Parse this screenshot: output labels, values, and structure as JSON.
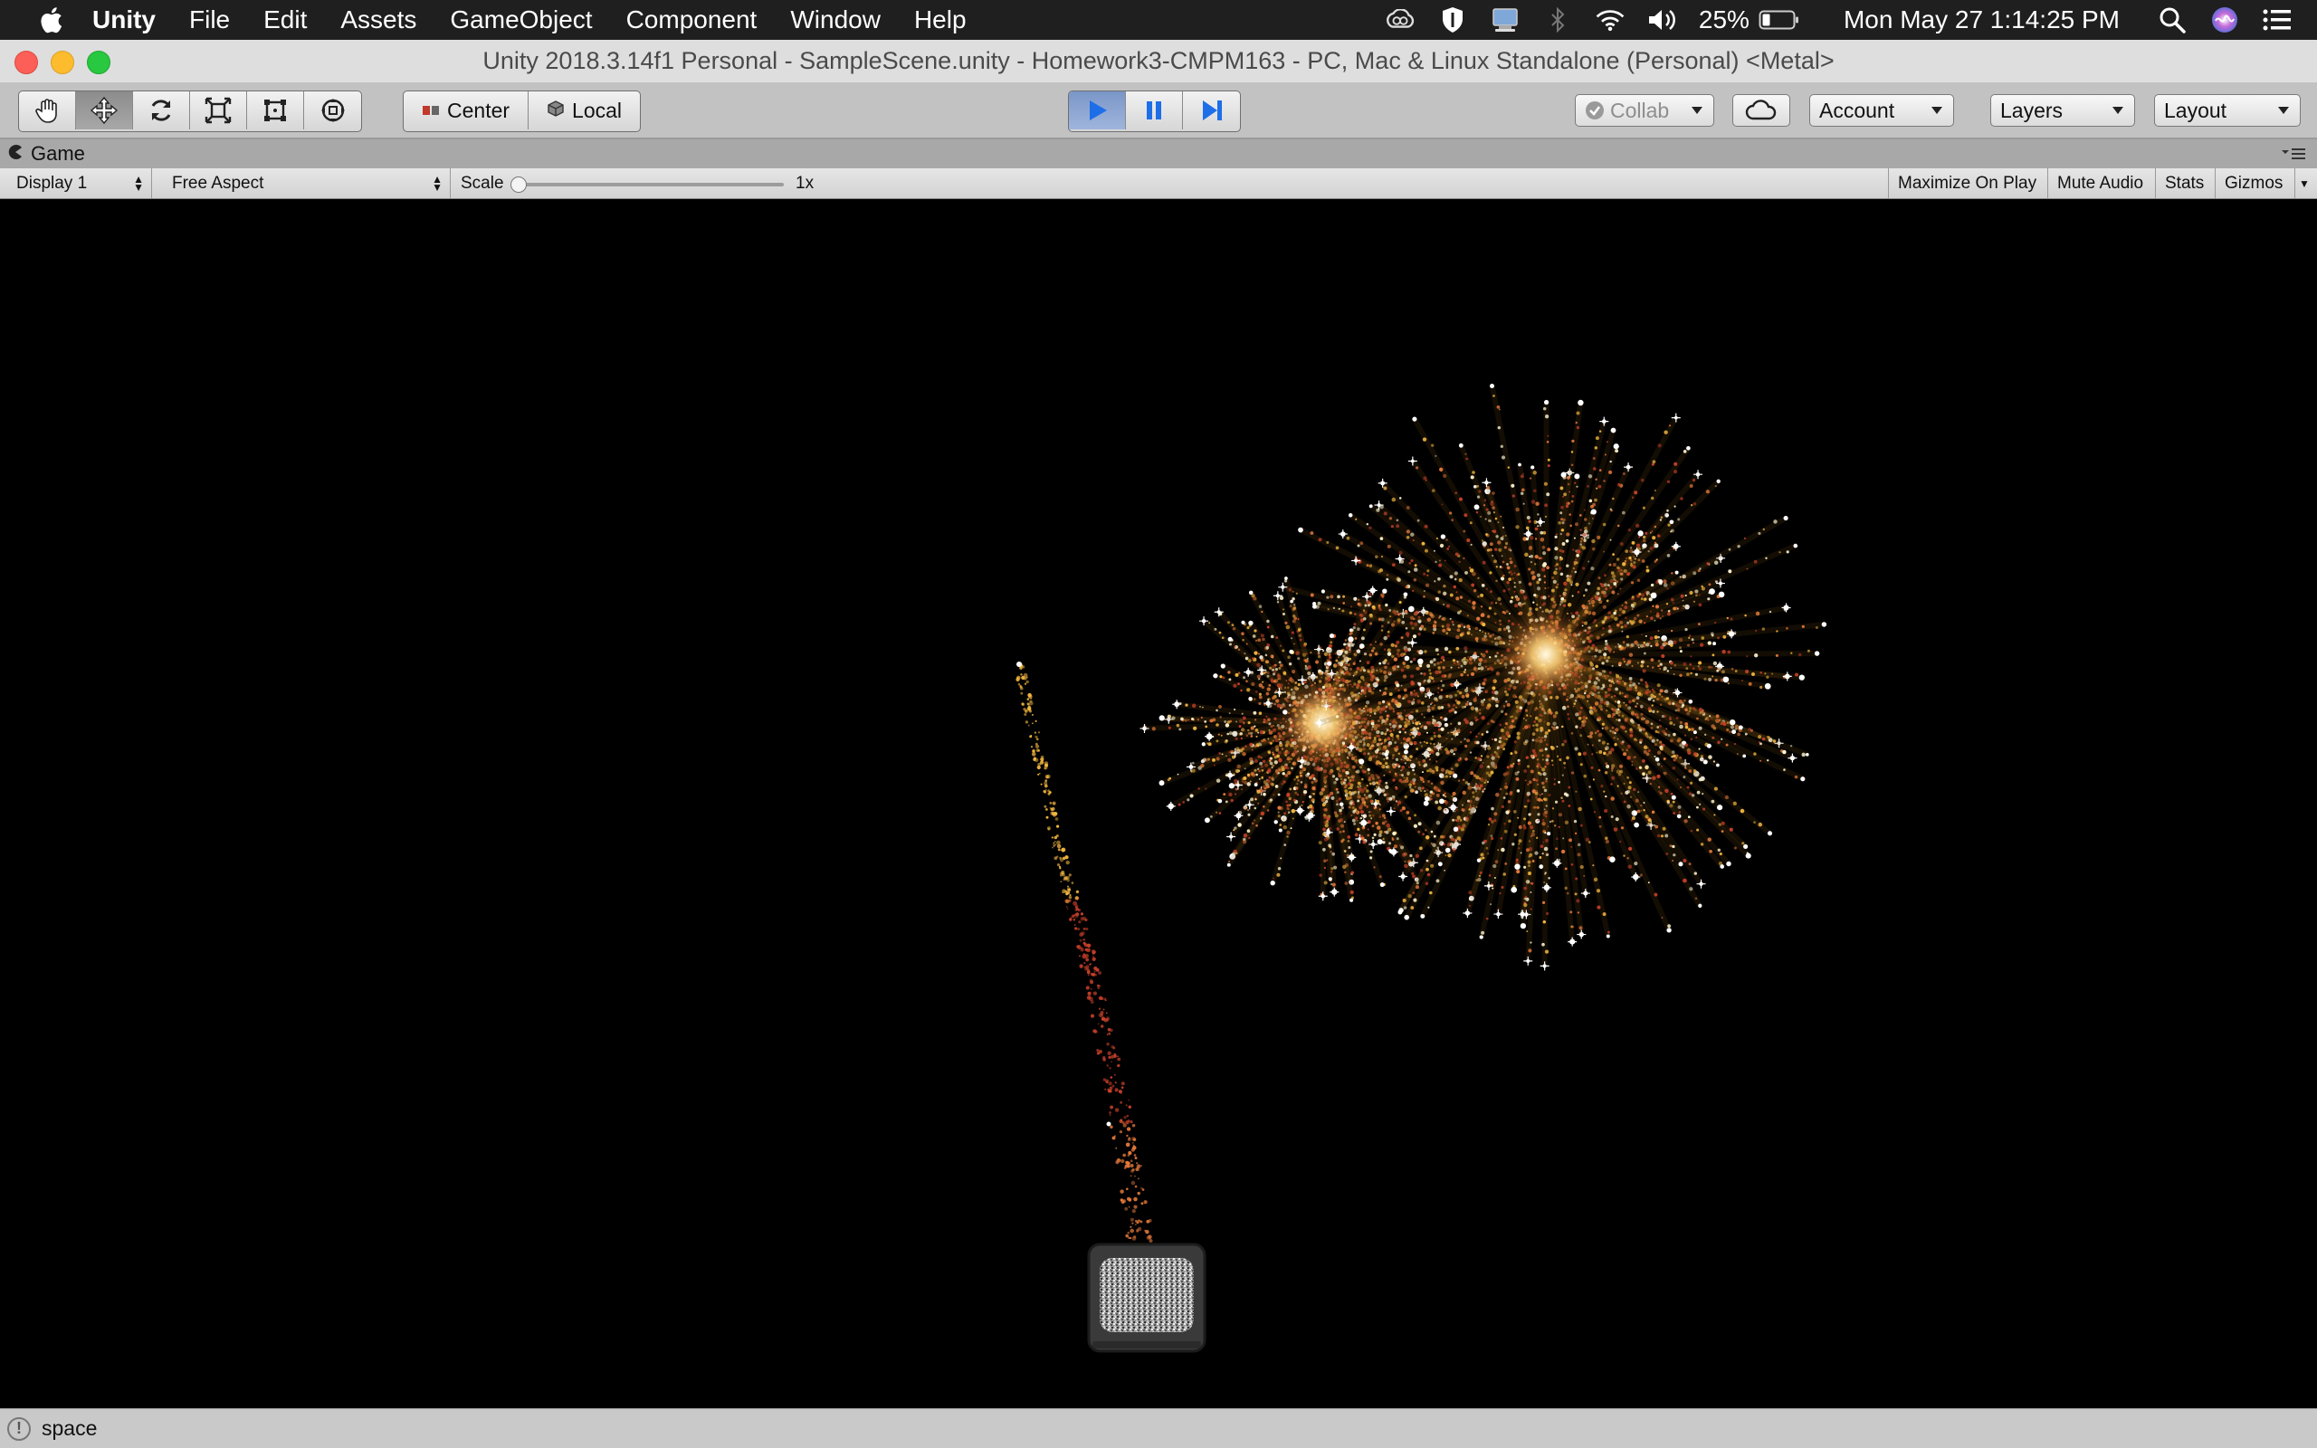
{
  "menubar": {
    "apple_icon": "apple-logo-icon",
    "app_name": "Unity",
    "items": [
      "File",
      "Edit",
      "Assets",
      "GameObject",
      "Component",
      "Window",
      "Help"
    ],
    "status_icons": [
      "creative-cloud-icon",
      "shield-icon",
      "network-drive-icon",
      "bluetooth-icon",
      "wifi-icon",
      "volume-icon"
    ],
    "battery_percent": "25%",
    "battery_level": 0.25,
    "datetime": "Mon May 27  1:14:25 PM",
    "right_icons": [
      "search-icon",
      "siri-icon",
      "notification-center-icon"
    ]
  },
  "window": {
    "title": "Unity 2018.3.14f1 Personal - SampleScene.unity - Homework3-CMPM163 - PC, Mac & Linux Standalone (Personal) <Metal>"
  },
  "toolbar": {
    "tools": [
      "hand-tool-icon",
      "move-tool-icon",
      "rotate-tool-icon",
      "scale-tool-icon",
      "rect-tool-icon",
      "transform-tool-icon"
    ],
    "active_tool": "move-tool-icon",
    "pivot_label": "Center",
    "space_label": "Local",
    "play_state": "playing",
    "collab_label": "Collab",
    "account_label": "Account",
    "layers_label": "Layers",
    "layout_label": "Layout"
  },
  "game_panel": {
    "tab_label": "Game",
    "display": "Display 1",
    "aspect": "Free Aspect",
    "scale_label": "Scale",
    "scale_value": "1x",
    "maximize_label": "Maximize On Play",
    "mute_label": "Mute Audio",
    "stats_label": "Stats",
    "gizmos_label": "Gizmos"
  },
  "status": {
    "icon": "info-icon",
    "message": "space"
  },
  "colors": {
    "spark_core": "#fff6d0",
    "spark_gold": "#f2b640",
    "spark_orange": "#e2783a",
    "spark_red": "#c8402a",
    "star_white": "#ffffff"
  }
}
